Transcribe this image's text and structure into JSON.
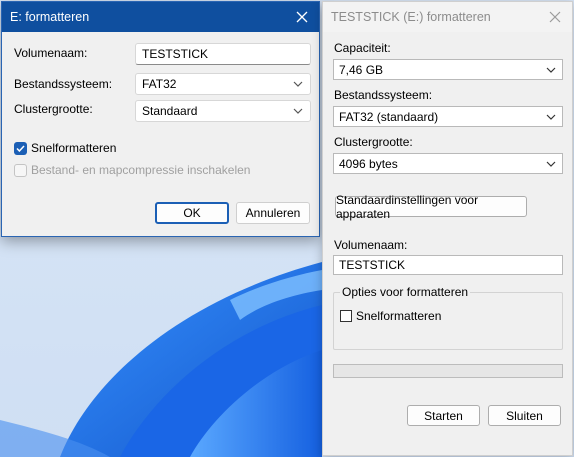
{
  "left_dialog": {
    "title": "E: formatteren",
    "volume_label": "Volumenaam:",
    "volume_value": "TESTSTICK",
    "filesystem_label": "Bestandssysteem:",
    "filesystem_value": "FAT32",
    "cluster_label": "Clustergrootte:",
    "cluster_value": "Standaard",
    "quick_format_label": "Snelformatteren",
    "quick_format_checked": true,
    "compression_label": "Bestand- en mapcompressie inschakelen",
    "compression_checked": false,
    "ok_label": "OK",
    "cancel_label": "Annuleren"
  },
  "right_dialog": {
    "title": "TESTSTICK (E:) formatteren",
    "capacity_label": "Capaciteit:",
    "capacity_value": "7,46 GB",
    "filesystem_label": "Bestandssysteem:",
    "filesystem_value": "FAT32 (standaard)",
    "cluster_label": "Clustergrootte:",
    "cluster_value": "4096 bytes",
    "defaults_button_label": "Standaardinstellingen voor apparaten",
    "volume_label": "Volumenaam:",
    "volume_value": "TESTSTICK",
    "options_group_label": "Opties voor formatteren",
    "quick_format_label": "Snelformatteren",
    "quick_format_checked": false,
    "progress": 0,
    "start_label": "Starten",
    "close_label": "Sluiten"
  },
  "colors": {
    "left_titlebar": "#0f4f9f",
    "accent": "#1b5fb5",
    "wallpaper_blue": "#1e6fe0"
  },
  "icons": [
    "close-icon",
    "chevron-down-icon",
    "checkmark-icon"
  ]
}
